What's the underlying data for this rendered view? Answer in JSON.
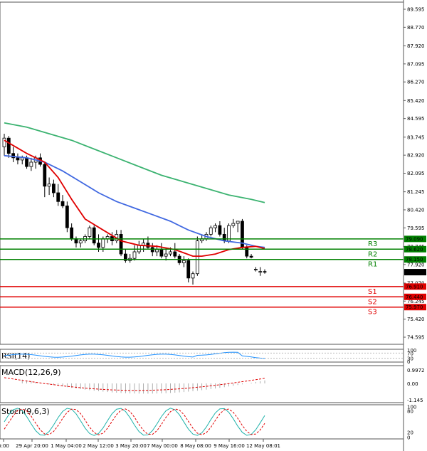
{
  "chart_data": {
    "type": "candlestick",
    "price_axis": {
      "min": 74.595,
      "max": 89.595,
      "ticks": [
        "89.595",
        "88.770",
        "87.920",
        "87.095",
        "86.270",
        "85.420",
        "84.595",
        "83.745",
        "82.920",
        "82.095",
        "81.245",
        "80.420",
        "79.595",
        "78.745",
        "77.920",
        "77.070",
        "76.245",
        "75.420",
        "74.595"
      ]
    },
    "time_axis": {
      "labels": [
        "6:00",
        "29 Apr 20:00",
        "1 May 04:00",
        "2 May 12:00",
        "3 May 20:00",
        "7 May 00:00",
        "8 May 08:00",
        "9 May 16:00",
        "12 May 08:01"
      ]
    },
    "current_price": {
      "value": 77.57,
      "label": "77.570"
    },
    "levels": [
      {
        "name": "R3",
        "value": 79.09,
        "label": "79.090",
        "color": "#008000"
      },
      {
        "name": "R2",
        "value": 78.62,
        "label": "78.620",
        "color": "#008000"
      },
      {
        "name": "R1",
        "value": 78.15,
        "label": "78.150",
        "color": "#008000"
      },
      {
        "name": "S1",
        "value": 76.91,
        "label": "76.910",
        "color": "#e00000"
      },
      {
        "name": "S2",
        "value": 76.44,
        "label": "76.440",
        "color": "#e00000"
      },
      {
        "name": "S3",
        "value": 75.97,
        "label": "75.970",
        "color": "#e00000"
      }
    ],
    "candles": [
      [
        83.3,
        83.9,
        82.9,
        83.7
      ],
      [
        83.7,
        83.8,
        82.8,
        83.0
      ],
      [
        83.0,
        83.3,
        82.6,
        82.8
      ],
      [
        82.8,
        83.0,
        82.5,
        82.7
      ],
      [
        82.7,
        82.9,
        82.5,
        82.8
      ],
      [
        82.8,
        82.9,
        82.3,
        82.4
      ],
      [
        82.4,
        82.8,
        82.2,
        82.6
      ],
      [
        82.6,
        82.9,
        82.3,
        82.8
      ],
      [
        82.8,
        83.0,
        82.4,
        82.5
      ],
      [
        82.5,
        82.6,
        81.0,
        81.5
      ],
      [
        81.5,
        81.9,
        81.1,
        81.6
      ],
      [
        81.6,
        81.8,
        81.0,
        81.2
      ],
      [
        81.2,
        81.6,
        80.6,
        80.8
      ],
      [
        80.8,
        81.1,
        80.5,
        80.6
      ],
      [
        80.6,
        80.8,
        79.4,
        79.6
      ],
      [
        79.6,
        79.8,
        79.0,
        79.1
      ],
      [
        79.1,
        79.2,
        78.7,
        78.9
      ],
      [
        78.9,
        79.1,
        78.7,
        79.0
      ],
      [
        79.0,
        79.3,
        78.9,
        79.2
      ],
      [
        79.2,
        79.7,
        79.1,
        79.6
      ],
      [
        79.6,
        79.7,
        78.8,
        78.9
      ],
      [
        78.9,
        79.3,
        78.5,
        78.7
      ],
      [
        78.7,
        79.2,
        78.5,
        79.1
      ],
      [
        79.1,
        79.3,
        78.9,
        79.2
      ],
      [
        79.2,
        79.4,
        78.8,
        79.0
      ],
      [
        79.0,
        79.5,
        78.9,
        79.3
      ],
      [
        79.3,
        79.5,
        78.3,
        78.4
      ],
      [
        78.4,
        78.6,
        78.0,
        78.1
      ],
      [
        78.1,
        78.4,
        78.0,
        78.2
      ],
      [
        78.2,
        78.8,
        78.1,
        78.5
      ],
      [
        78.5,
        79.0,
        78.4,
        78.8
      ],
      [
        78.8,
        79.1,
        78.5,
        78.9
      ],
      [
        78.9,
        79.2,
        78.6,
        78.7
      ],
      [
        78.7,
        78.9,
        78.3,
        78.5
      ],
      [
        78.5,
        78.8,
        78.3,
        78.6
      ],
      [
        78.6,
        78.9,
        78.2,
        78.3
      ],
      [
        78.3,
        78.6,
        78.1,
        78.4
      ],
      [
        78.4,
        78.7,
        78.3,
        78.5
      ],
      [
        78.5,
        78.9,
        78.2,
        78.3
      ],
      [
        78.3,
        78.4,
        77.9,
        78.0
      ],
      [
        78.0,
        78.3,
        77.8,
        78.1
      ],
      [
        78.1,
        78.2,
        77.1,
        77.3
      ],
      [
        77.3,
        77.6,
        77.0,
        77.5
      ],
      [
        77.5,
        79.2,
        77.4,
        79.0
      ],
      [
        79.0,
        79.3,
        78.9,
        79.1
      ],
      [
        79.1,
        79.4,
        79.0,
        79.3
      ],
      [
        79.3,
        79.7,
        79.2,
        79.6
      ],
      [
        79.6,
        79.8,
        79.4,
        79.7
      ],
      [
        79.7,
        79.9,
        79.2,
        79.3
      ],
      [
        79.3,
        79.6,
        78.9,
        79.0
      ],
      [
        79.0,
        79.8,
        78.9,
        79.7
      ],
      [
        79.7,
        80.0,
        79.6,
        79.8
      ],
      [
        79.8,
        79.9,
        79.4,
        79.9
      ],
      [
        79.9,
        80.0,
        78.6,
        78.7
      ],
      [
        78.7,
        78.8,
        78.2,
        78.3
      ],
      [
        78.3,
        78.4,
        78.2,
        78.25
      ],
      [
        77.7,
        77.8,
        77.6,
        77.7
      ],
      [
        77.6,
        77.8,
        77.4,
        77.6
      ],
      [
        77.6,
        77.7,
        77.5,
        77.57
      ]
    ],
    "ma_fast": [
      [
        0,
        83.6
      ],
      [
        5,
        83.0
      ],
      [
        9,
        82.6
      ],
      [
        12,
        81.9
      ],
      [
        15,
        80.9
      ],
      [
        18,
        80.0
      ],
      [
        22,
        79.5
      ],
      [
        26,
        79.0
      ],
      [
        30,
        78.8
      ],
      [
        34,
        78.75
      ],
      [
        38,
        78.6
      ],
      [
        42,
        78.3
      ],
      [
        44,
        78.3
      ],
      [
        47,
        78.4
      ],
      [
        50,
        78.6
      ],
      [
        53,
        78.7
      ],
      [
        56,
        78.75
      ],
      [
        58,
        78.65
      ]
    ],
    "ma_mid": [
      [
        0,
        82.9
      ],
      [
        5,
        82.8
      ],
      [
        9,
        82.6
      ],
      [
        13,
        82.2
      ],
      [
        17,
        81.7
      ],
      [
        21,
        81.2
      ],
      [
        25,
        80.8
      ],
      [
        29,
        80.5
      ],
      [
        33,
        80.2
      ],
      [
        37,
        79.9
      ],
      [
        41,
        79.5
      ],
      [
        45,
        79.2
      ],
      [
        49,
        79.0
      ],
      [
        53,
        78.9
      ],
      [
        56,
        78.75
      ],
      [
        58,
        78.7
      ]
    ],
    "ma_slow": [
      [
        0,
        84.4
      ],
      [
        5,
        84.2
      ],
      [
        10,
        83.9
      ],
      [
        15,
        83.6
      ],
      [
        20,
        83.2
      ],
      [
        25,
        82.8
      ],
      [
        30,
        82.4
      ],
      [
        35,
        82.0
      ],
      [
        40,
        81.7
      ],
      [
        45,
        81.4
      ],
      [
        50,
        81.1
      ],
      [
        55,
        80.9
      ],
      [
        58,
        80.75
      ]
    ],
    "rsi": {
      "label": "RSI(14)",
      "ticks": [
        "100",
        "70",
        "30",
        "0"
      ]
    },
    "macd": {
      "label": "MACD(12,26,9)",
      "ticks": [
        "0.9972",
        "0.00",
        "-1.145"
      ]
    },
    "stoch": {
      "label": "Stoch(9,6,3)",
      "ticks": [
        "100",
        "80",
        "20",
        "0"
      ]
    }
  }
}
